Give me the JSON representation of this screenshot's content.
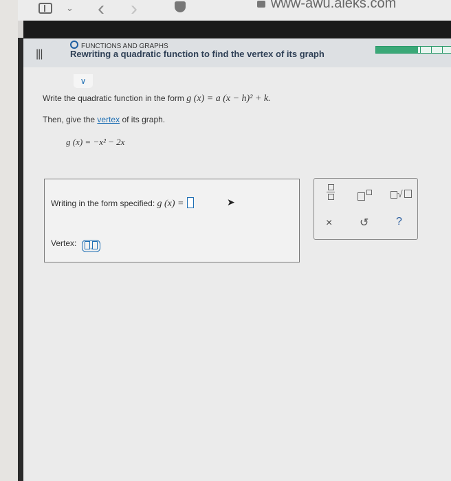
{
  "browser": {
    "url": "www-awu.aleks.com",
    "back_icon": "chevron-left-icon",
    "forward_icon": "chevron-right-icon"
  },
  "header": {
    "topic": "FUNCTIONS AND GRAPHS",
    "lesson_title": "Rewriting a quadratic function to find the vertex of its graph",
    "progress_fraction": 0.55
  },
  "question": {
    "line1_prefix": "Write the quadratic function in the form",
    "form_expr": "g (x) = a (x − h)² + k.",
    "line2_prefix": "Then, give the",
    "vertex_link": "vertex",
    "line2_suffix": "of its graph.",
    "given_function": "g (x) = −x² − 2x"
  },
  "answer": {
    "row1_label": "Writing in the form specified:",
    "row1_expr": "g (x) =",
    "vertex_label": "Vertex:",
    "vertex_comma": ","
  },
  "toolbox": {
    "clear": "×",
    "undo": "↺",
    "help": "?"
  }
}
